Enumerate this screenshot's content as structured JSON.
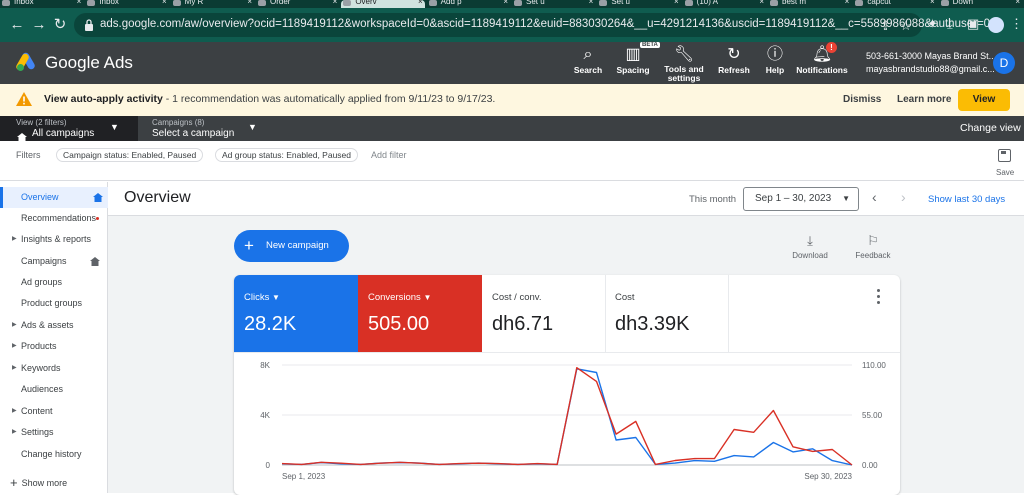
{
  "browser": {
    "tabs": [
      {
        "title": "Inbox"
      },
      {
        "title": "Inbox"
      },
      {
        "title": "My R"
      },
      {
        "title": "Order"
      },
      {
        "title": "Overv",
        "active": true
      },
      {
        "title": "Add p"
      },
      {
        "title": "Set u"
      },
      {
        "title": "Set u"
      },
      {
        "title": "(10) A"
      },
      {
        "title": "best m"
      },
      {
        "title": "capcut"
      },
      {
        "title": "Down"
      }
    ],
    "url": "ads.google.com/aw/overview?ocid=1189419112&workspaceId=0&ascid=1189419112&euid=883030264&__u=4291214136&uscid=1189419112&__c=5589986088&authuser=0"
  },
  "header": {
    "title": "Google Ads",
    "actions": [
      {
        "label": "Search",
        "icon": "search-icon"
      },
      {
        "label": "Spacing",
        "icon": "spacing-icon",
        "badge": "BETA"
      },
      {
        "label1": "Tools and",
        "label2": "settings",
        "icon": "wrench-icon"
      },
      {
        "label": "Refresh",
        "icon": "refresh-icon"
      },
      {
        "label": "Help",
        "icon": "help-icon"
      },
      {
        "label": "Notifications",
        "icon": "bell-icon",
        "count": "!"
      }
    ],
    "account_line1": "503-661-3000 Mayas Brand St...",
    "account_line2": "mayasbrandstudio88@gmail.c...",
    "avatar_letter": "D"
  },
  "banner": {
    "bold_text": "View auto-apply activity",
    "text": " - 1 recommendation was automatically applied from 9/11/23 to 9/17/23.",
    "dismiss": "Dismiss",
    "learn_more": "Learn more",
    "view": "View"
  },
  "scope": {
    "view_small": "View (2 filters)",
    "view_big": "All campaigns",
    "campaigns_small": "Campaigns (8)",
    "campaigns_big": "Select a campaign",
    "change_view": "Change view"
  },
  "filters": {
    "label": "Filters",
    "chips": [
      "Campaign status: Enabled, Paused",
      "Ad group status: Enabled, Paused"
    ],
    "add_filter": "Add filter",
    "save": "Save"
  },
  "sidebar": {
    "items": [
      {
        "label": "Overview",
        "active": true,
        "home": true
      },
      {
        "label": "Recommendations",
        "dot": true
      },
      {
        "label": "Insights & reports",
        "arrow": true
      },
      {
        "label": "Campaigns",
        "home": true
      },
      {
        "label": "Ad groups"
      },
      {
        "label": "Product groups"
      },
      {
        "label": "Ads & assets",
        "arrow": true
      },
      {
        "label": "Products",
        "arrow": true
      },
      {
        "label": "Keywords",
        "arrow": true
      },
      {
        "label": "Audiences"
      },
      {
        "label": "Content",
        "arrow": true
      },
      {
        "label": "Settings",
        "arrow": true
      },
      {
        "label": "Change history"
      }
    ],
    "show_more": "Show more"
  },
  "overview": {
    "title": "Overview",
    "this_month": "This month",
    "date_range": "Sep 1 – 30, 2023",
    "show_last": "Show last 30 days",
    "new_campaign": "New campaign",
    "download": "Download",
    "feedback": "Feedback",
    "metrics": [
      {
        "label": "Clicks",
        "value": "28.2K",
        "dropdown": true
      },
      {
        "label": "Conversions",
        "value": "505.00",
        "dropdown": true
      },
      {
        "label": "Cost / conv.",
        "value": "dh6.71"
      },
      {
        "label": "Cost",
        "value": "dh3.39K"
      }
    ]
  },
  "colors": {
    "blue": "#1a73e8",
    "red": "#d93025",
    "header_bg": "#3c4043",
    "banner_bg": "#fef7e0",
    "view_btn": "#fbbc04"
  },
  "chart_data": {
    "type": "line",
    "x_tick_labels": [
      "Sep 1, 2023",
      "Sep 30, 2023"
    ],
    "x": [
      1,
      2,
      3,
      4,
      5,
      6,
      7,
      8,
      9,
      10,
      11,
      12,
      13,
      14,
      15,
      16,
      17,
      18,
      19,
      20,
      21,
      22,
      23,
      24,
      25,
      26,
      27,
      28,
      29,
      30
    ],
    "y_left": {
      "ticks": [
        "0",
        "4K",
        "8K"
      ],
      "range": [
        0,
        8000
      ]
    },
    "y_right": {
      "ticks": [
        "0.00",
        "55.00",
        "110.00"
      ],
      "range": [
        0,
        110
      ]
    },
    "series": [
      {
        "axis": "left",
        "color": "#1a73e8",
        "values": [
          100,
          50,
          200,
          100,
          50,
          150,
          200,
          150,
          50,
          100,
          150,
          100,
          50,
          100,
          50,
          7700,
          7400,
          2000,
          2200,
          50,
          150,
          350,
          300,
          750,
          650,
          1800,
          1050,
          1300,
          350,
          0
        ]
      },
      {
        "axis": "right",
        "color": "#d93025",
        "values": [
          1.5,
          0.7,
          3.0,
          2.0,
          0.7,
          2.0,
          3.0,
          2.0,
          0.7,
          1.5,
          2.0,
          1.5,
          0.7,
          1.5,
          0.7,
          107,
          92,
          34,
          48,
          0.7,
          5.0,
          7.0,
          7.0,
          39,
          36,
          60,
          20,
          15,
          17,
          0
        ]
      }
    ],
    "grid": true
  }
}
